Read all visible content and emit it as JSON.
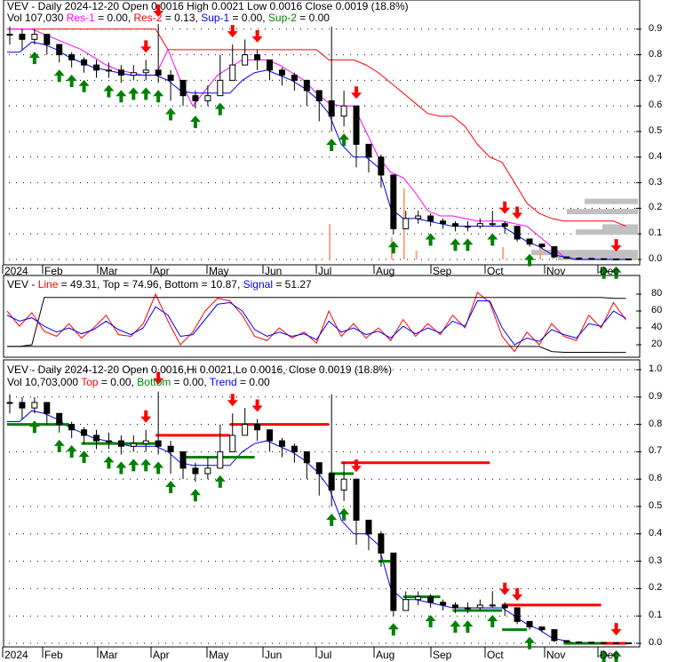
{
  "header1": {
    "title": "VEV - Daily 2024-12-20 Open 0.0016  High 0.0021  Low 0.0016  Close 0.0019 (18.8%)",
    "vol": "Vol 107,030",
    "res1": "Res-1",
    "res1_val": " = 0.00, ",
    "res2": "Res-2",
    "res2_val": " = 0.13, ",
    "sup1": "Sup-1",
    "sup1_val": " = 0.00, ",
    "sup2": "Sup-2",
    "sup2_val": " = 0.00"
  },
  "header2": {
    "prefix": "VEV - ",
    "line": "Line",
    "line_val": " = 49.31, Top = 74.96, Bottom = 10.87, ",
    "signal": "Signal",
    "signal_val": " = 51.27"
  },
  "header3": {
    "title": "VEV - Daily 2024-12-20 Open 0.0016,Hi 0.0021,Lo 0.0016, Close 0.0019 (18.8%)",
    "vol": "Vol 10,703,000",
    "top": "Top",
    "top_val": " = 0.00, ",
    "bottom": "Bottom",
    "bottom_val": " = 0.00, ",
    "trend": "Trend",
    "trend_val": " = 0.00"
  },
  "colors": {
    "res1": "#ff00ff",
    "res2": "#ff0000",
    "sup1": "#0000ff",
    "sup2": "#008000",
    "up": "#008000",
    "down": "#ff0000",
    "volume": "#f4a582",
    "profile": "#c0c0c0"
  },
  "chart_data": [
    {
      "type": "line",
      "title": "VEV - Daily (price with support/resistance)",
      "months": [
        "2024",
        "Feb",
        "Mar",
        "Apr",
        "May",
        "Jun",
        "Jul",
        "Aug",
        "Sep",
        "Oct",
        "Nov",
        "Dec"
      ],
      "yticks": [
        "0.9",
        "0.8",
        "0.7",
        "0.6",
        "0.5",
        "0.4",
        "0.3",
        "0.2",
        "0.1",
        "0.0"
      ],
      "ylim": [
        0,
        0.9
      ],
      "x_weeks": [
        0,
        7,
        14,
        21,
        28,
        35,
        42,
        49,
        56,
        63,
        70,
        77,
        84,
        91,
        98,
        105,
        112,
        119,
        126,
        133,
        140,
        147,
        154,
        161,
        168,
        175,
        182,
        189,
        196,
        203,
        210,
        217,
        224,
        231,
        238,
        245,
        252,
        259,
        266,
        273,
        280,
        287,
        294,
        301,
        308,
        315,
        322,
        329,
        336,
        343,
        350
      ],
      "close": [
        0.88,
        0.86,
        0.88,
        0.84,
        0.8,
        0.78,
        0.76,
        0.74,
        0.74,
        0.72,
        0.73,
        0.74,
        0.72,
        0.7,
        0.64,
        0.62,
        0.64,
        0.7,
        0.76,
        0.8,
        0.78,
        0.74,
        0.72,
        0.7,
        0.66,
        0.62,
        0.56,
        0.6,
        0.45,
        0.4,
        0.33,
        0.12,
        0.16,
        0.17,
        0.15,
        0.14,
        0.13,
        0.13,
        0.14,
        0.14,
        0.13,
        0.08,
        0.06,
        0.05,
        0.01,
        0.005,
        0.004,
        0.003,
        0.002,
        0.002,
        0.0019
      ],
      "high": [
        0.91,
        0.9,
        0.9,
        0.88,
        0.84,
        0.81,
        0.79,
        0.78,
        0.77,
        0.76,
        0.76,
        0.78,
        0.92,
        0.74,
        0.7,
        0.66,
        0.68,
        0.8,
        0.84,
        0.86,
        0.82,
        0.78,
        0.75,
        0.73,
        0.7,
        0.66,
        0.91,
        0.66,
        0.6,
        0.44,
        0.41,
        0.3,
        0.19,
        0.19,
        0.18,
        0.16,
        0.15,
        0.15,
        0.16,
        0.19,
        0.15,
        0.13,
        0.08,
        0.06,
        0.05,
        0.01,
        0.008,
        0.005,
        0.004,
        0.003,
        0.0021
      ],
      "low": [
        0.84,
        0.82,
        0.84,
        0.8,
        0.77,
        0.75,
        0.73,
        0.71,
        0.71,
        0.69,
        0.7,
        0.7,
        0.69,
        0.62,
        0.6,
        0.59,
        0.6,
        0.64,
        0.71,
        0.76,
        0.74,
        0.7,
        0.68,
        0.66,
        0.6,
        0.54,
        0.5,
        0.52,
        0.36,
        0.34,
        0.28,
        0.1,
        0.12,
        0.14,
        0.13,
        0.12,
        0.11,
        0.11,
        0.12,
        0.13,
        0.1,
        0.07,
        0.05,
        0.04,
        0.005,
        0.003,
        0.002,
        0.002,
        0.001,
        0.001,
        0.0016
      ],
      "series": [
        {
          "name": "Res-2",
          "values": [
            0.9,
            0.9,
            0.9,
            0.9,
            0.9,
            0.9,
            0.9,
            0.9,
            0.9,
            0.9,
            0.9,
            0.9,
            0.9,
            0.82,
            0.82,
            0.82,
            0.82,
            0.82,
            0.82,
            0.82,
            0.82,
            0.82,
            0.82,
            0.82,
            0.82,
            0.82,
            0.78,
            0.78,
            0.78,
            0.76,
            0.73,
            0.69,
            0.65,
            0.61,
            0.57,
            0.56,
            0.56,
            0.52,
            0.45,
            0.4,
            0.38,
            0.3,
            0.22,
            0.18,
            0.16,
            0.15,
            0.15,
            0.15,
            0.15,
            0.15,
            0.13
          ]
        },
        {
          "name": "Res-1",
          "values": [
            0.9,
            0.9,
            0.9,
            0.88,
            0.86,
            0.84,
            0.82,
            0.79,
            0.76,
            0.74,
            0.73,
            0.72,
            0.72,
            0.82,
            0.7,
            0.6,
            0.66,
            0.72,
            0.75,
            0.78,
            0.78,
            0.78,
            0.76,
            0.73,
            0.7,
            0.65,
            0.61,
            0.6,
            0.6,
            0.5,
            0.4,
            0.34,
            0.32,
            0.26,
            0.19,
            0.17,
            0.17,
            0.16,
            0.15,
            0.15,
            0.15,
            0.14,
            0.13,
            0.09,
            0.05,
            0.01,
            0.0,
            0.0,
            0.0,
            0.0,
            0.0
          ]
        },
        {
          "name": "Sup-1",
          "values": [
            0.81,
            0.81,
            0.85,
            0.84,
            0.82,
            0.79,
            0.77,
            0.75,
            0.74,
            0.73,
            0.72,
            0.72,
            0.72,
            0.7,
            0.66,
            0.65,
            0.65,
            0.65,
            0.65,
            0.7,
            0.73,
            0.74,
            0.72,
            0.7,
            0.67,
            0.63,
            0.57,
            0.45,
            0.4,
            0.4,
            0.36,
            0.2,
            0.16,
            0.16,
            0.15,
            0.14,
            0.13,
            0.13,
            0.13,
            0.13,
            0.13,
            0.1,
            0.07,
            0.05,
            0.02,
            0.01,
            0.0,
            0.0,
            0.0,
            0.0,
            0.0
          ]
        }
      ],
      "up_arrows": [
        14,
        28,
        35,
        42,
        56,
        63,
        70,
        77,
        84,
        91,
        105,
        119,
        182,
        189,
        217,
        238,
        252,
        259,
        273,
        294,
        336,
        343
      ],
      "down_arrows": [
        77,
        84,
        126,
        140,
        196,
        280,
        287,
        343
      ]
    },
    {
      "type": "line",
      "title": "VEV oscillator",
      "yticks": [
        "80",
        "60",
        "40",
        "20"
      ],
      "ylim": [
        0,
        90
      ],
      "series": [
        {
          "name": "Line",
          "values": [
            60,
            42,
            58,
            36,
            30,
            45,
            28,
            40,
            55,
            32,
            30,
            45,
            80,
            48,
            20,
            35,
            60,
            75,
            72,
            55,
            30,
            25,
            40,
            28,
            35,
            22,
            60,
            30,
            45,
            28,
            40,
            25,
            50,
            30,
            45,
            32,
            55,
            40,
            82,
            70,
            30,
            12,
            35,
            20,
            45,
            30,
            25,
            55,
            40,
            70,
            49.31
          ]
        },
        {
          "name": "Signal",
          "values": [
            55,
            48,
            52,
            42,
            35,
            40,
            33,
            38,
            48,
            38,
            32,
            40,
            65,
            55,
            30,
            32,
            50,
            68,
            70,
            60,
            38,
            30,
            35,
            30,
            33,
            26,
            48,
            35,
            40,
            32,
            36,
            28,
            42,
            33,
            40,
            34,
            48,
            42,
            72,
            72,
            40,
            20,
            28,
            24,
            38,
            32,
            28,
            45,
            42,
            60,
            51.27
          ]
        },
        {
          "name": "Top",
          "values": [
            18,
            18,
            20,
            76,
            76,
            76,
            76,
            76,
            76,
            76,
            76,
            76,
            76,
            76,
            76,
            76,
            76,
            76,
            76,
            76,
            76,
            76,
            76,
            76,
            76,
            76,
            76,
            76,
            76,
            76,
            76,
            76,
            76,
            76,
            76,
            76,
            76,
            76,
            76,
            76,
            76,
            76,
            76,
            76,
            76,
            76,
            76,
            76,
            76,
            74.96,
            74.96
          ]
        },
        {
          "name": "Bottom",
          "values": [
            18,
            18,
            18,
            18,
            18,
            18,
            18,
            18,
            18,
            18,
            18,
            18,
            18,
            18,
            18,
            18,
            18,
            18,
            18,
            18,
            18,
            18,
            18,
            18,
            18,
            18,
            18,
            18,
            18,
            18,
            18,
            18,
            18,
            18,
            18,
            18,
            18,
            18,
            18,
            18,
            18,
            18,
            18,
            18,
            12,
            11,
            11,
            11,
            11,
            10.87,
            10.87
          ]
        }
      ]
    },
    {
      "type": "line",
      "title": "VEV - Daily (trend panel)",
      "yticks": [
        "1.0",
        "0.9",
        "0.8",
        "0.7",
        "0.6",
        "0.5",
        "0.4",
        "0.3",
        "0.2",
        "0.1",
        "0.0"
      ],
      "ylim": [
        0,
        1.0
      ]
    }
  ]
}
